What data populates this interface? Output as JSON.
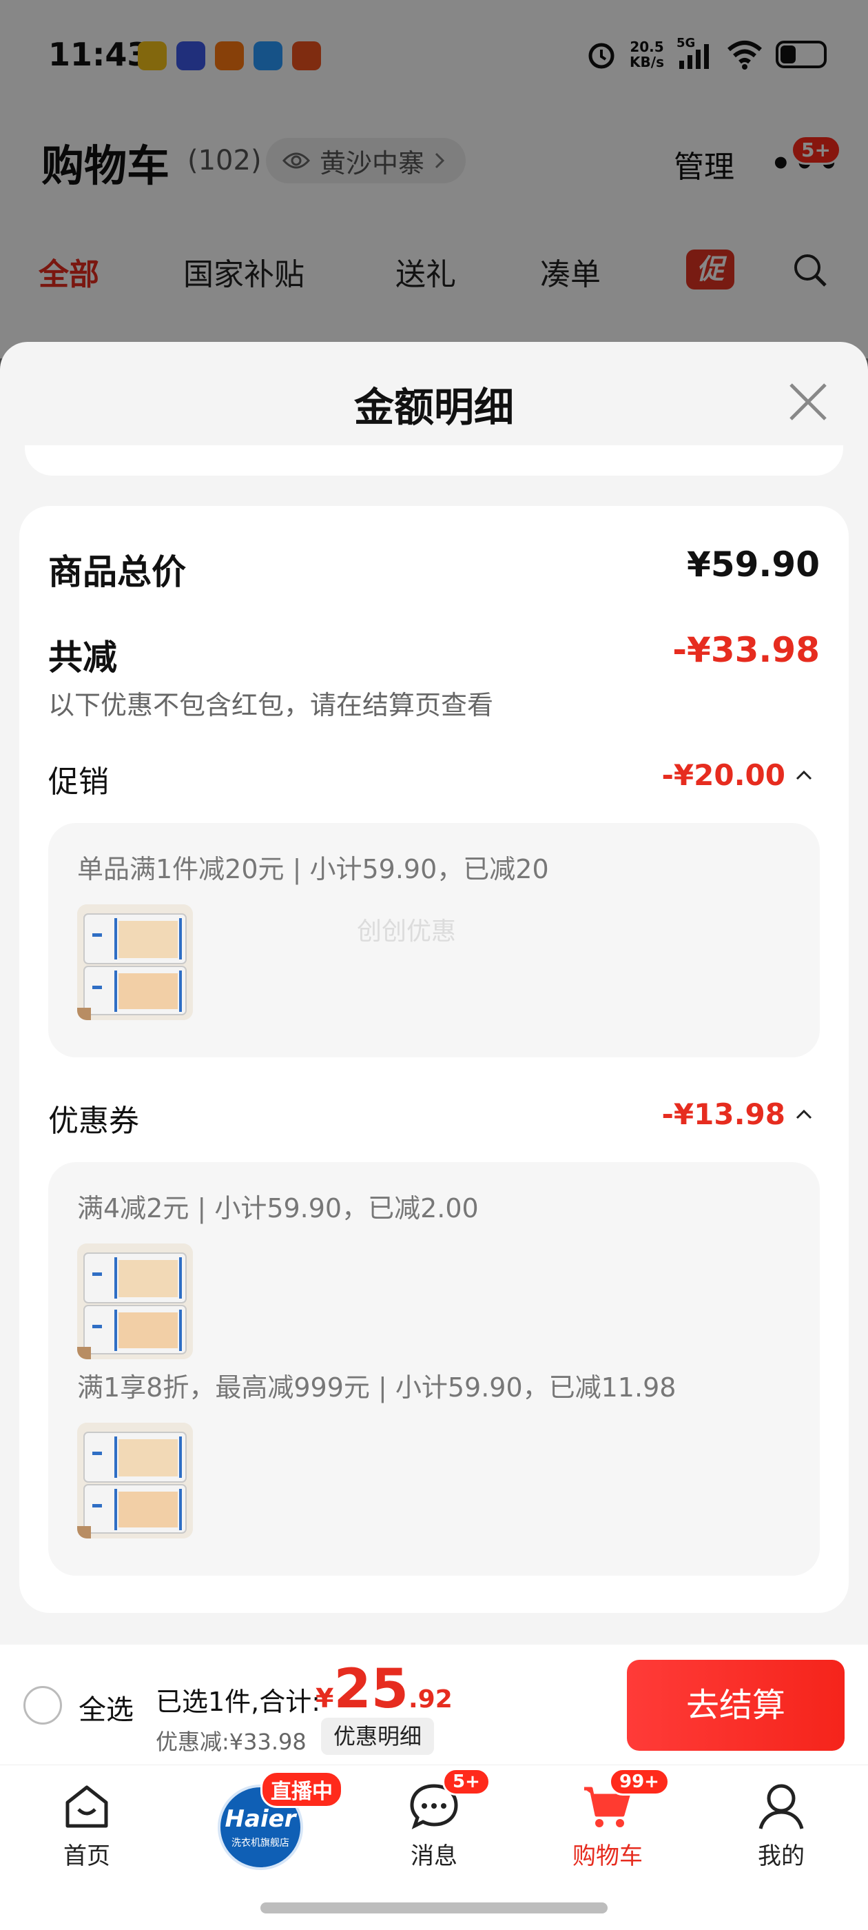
{
  "status_bar": {
    "time": "11:43",
    "net_speed_value": "20.5",
    "net_speed_unit": "KB/s",
    "network": "5G"
  },
  "cart_header": {
    "title": "购物车",
    "count": "(102)",
    "location": "黄沙中寨",
    "manage": "管理",
    "more_badge": "5+"
  },
  "cart_tabs": [
    {
      "label": "全部",
      "active": true
    },
    {
      "label": "国家补贴",
      "active": false
    },
    {
      "label": "送礼",
      "active": false
    },
    {
      "label": "凑单",
      "active": false
    }
  ],
  "promo_tag": "促",
  "sheet": {
    "title": "金额明细",
    "total_label": "商品总价",
    "total_value": "¥59.90",
    "discount_label": "共减",
    "discount_value": "-¥33.98",
    "discount_note": "以下优惠不包含红包，请在结算页查看",
    "promotion": {
      "label": "促销",
      "value": "-¥20.00",
      "rule": "单品满1件减20元 | 小计59.90，已减20",
      "watermark": "创创优惠"
    },
    "coupon": {
      "label": "优惠券",
      "value": "-¥13.98",
      "rule1": "满4减2元 | 小计59.90，已减2.00",
      "rule2": "满1享8折，最高减999元 | 小计59.90，已减11.98"
    }
  },
  "checkout": {
    "select_all": "全选",
    "selected": "已选1件,合计:",
    "total_symbol": "¥",
    "total_int": "25",
    "total_dec": ".92",
    "saved": "优惠减:¥33.98",
    "detail_button": "优惠明细",
    "checkout_button": "去结算"
  },
  "bottom_nav": {
    "home": "首页",
    "live_badge": "直播中",
    "live_logo": "Haier",
    "live_sub": "洗衣机旗舰店",
    "messages": "消息",
    "messages_badge": "5+",
    "cart": "购物车",
    "cart_badge": "99+",
    "me": "我的"
  },
  "colors": {
    "accent": "#e62c1f",
    "checkout_button": "#f5241b"
  }
}
